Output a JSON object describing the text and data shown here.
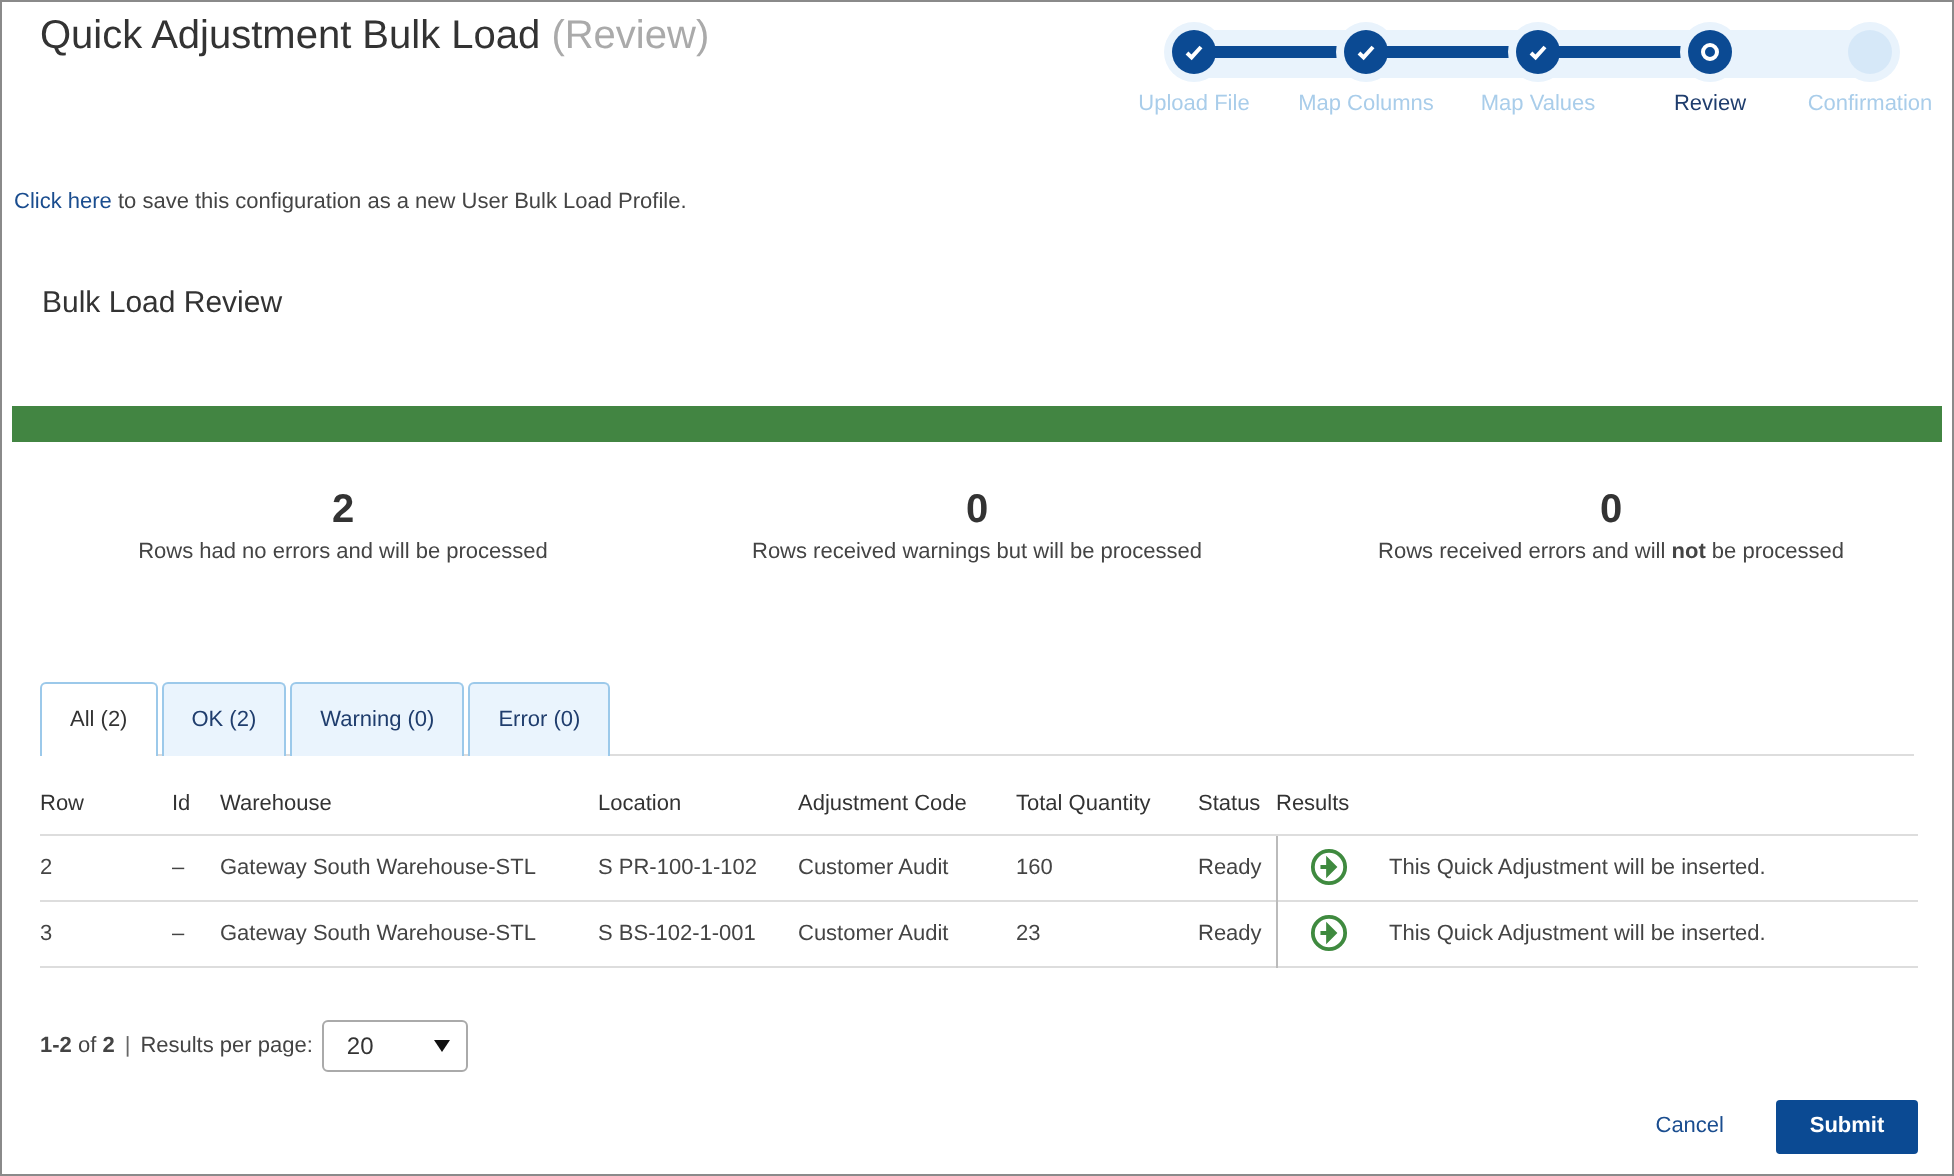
{
  "page_title": {
    "title": "Quick Adjustment Bulk Load",
    "suffix": "(Review)"
  },
  "steps": [
    {
      "label": "Upload File",
      "completed": true,
      "selected": false
    },
    {
      "label": "Map Columns",
      "completed": true,
      "selected": false
    },
    {
      "label": "Map Values",
      "completed": true,
      "selected": false
    },
    {
      "label": "Review",
      "completed": false,
      "selected": true
    },
    {
      "label": "Confirmation",
      "completed": false,
      "selected": false
    }
  ],
  "save_profile": {
    "link": "Click here",
    "text": "to save this configuration as a new User Bulk Load Profile."
  },
  "section_title": "Bulk Load Review",
  "progress": {
    "level": 1
  },
  "summary": [
    {
      "count": "2",
      "caption": "Rows had no errors and will be processed"
    },
    {
      "count": "0",
      "caption": "Rows received warnings but will be processed"
    },
    {
      "count": "0",
      "caption": "Rows received errors and will **not** be processed"
    }
  ],
  "tabs": [
    {
      "label": "All (2)",
      "selected": true
    },
    {
      "label": "OK (2)",
      "selected": false
    },
    {
      "label": "Warning (0)",
      "selected": false
    },
    {
      "label": "Error (0)",
      "selected": false
    }
  ],
  "table": {
    "columns": [
      "Row",
      "Id",
      "Warehouse",
      "Location",
      "Adjustment Code",
      "Total Quantity",
      "Status",
      "Results"
    ],
    "rows": [
      {
        "cells": [
          "2",
          "–",
          "Gateway South Warehouse-STL",
          "S PR-100-1-102",
          "Customer Audit",
          "160",
          "Ready"
        ],
        "result": "This Quick Adjustment will be inserted."
      },
      {
        "cells": [
          "3",
          "–",
          "Gateway South Warehouse-STL",
          "S BS-102-1-001",
          "Customer Audit",
          "23",
          "Ready"
        ],
        "result": "This Quick Adjustment will be inserted."
      }
    ]
  },
  "pagination": {
    "range": "**1-2** of **2**",
    "separator": "|",
    "label": "Results per page:",
    "per_page": "20"
  },
  "buttons": {
    "cancel": "Cancel",
    "submit": "Submit"
  }
}
